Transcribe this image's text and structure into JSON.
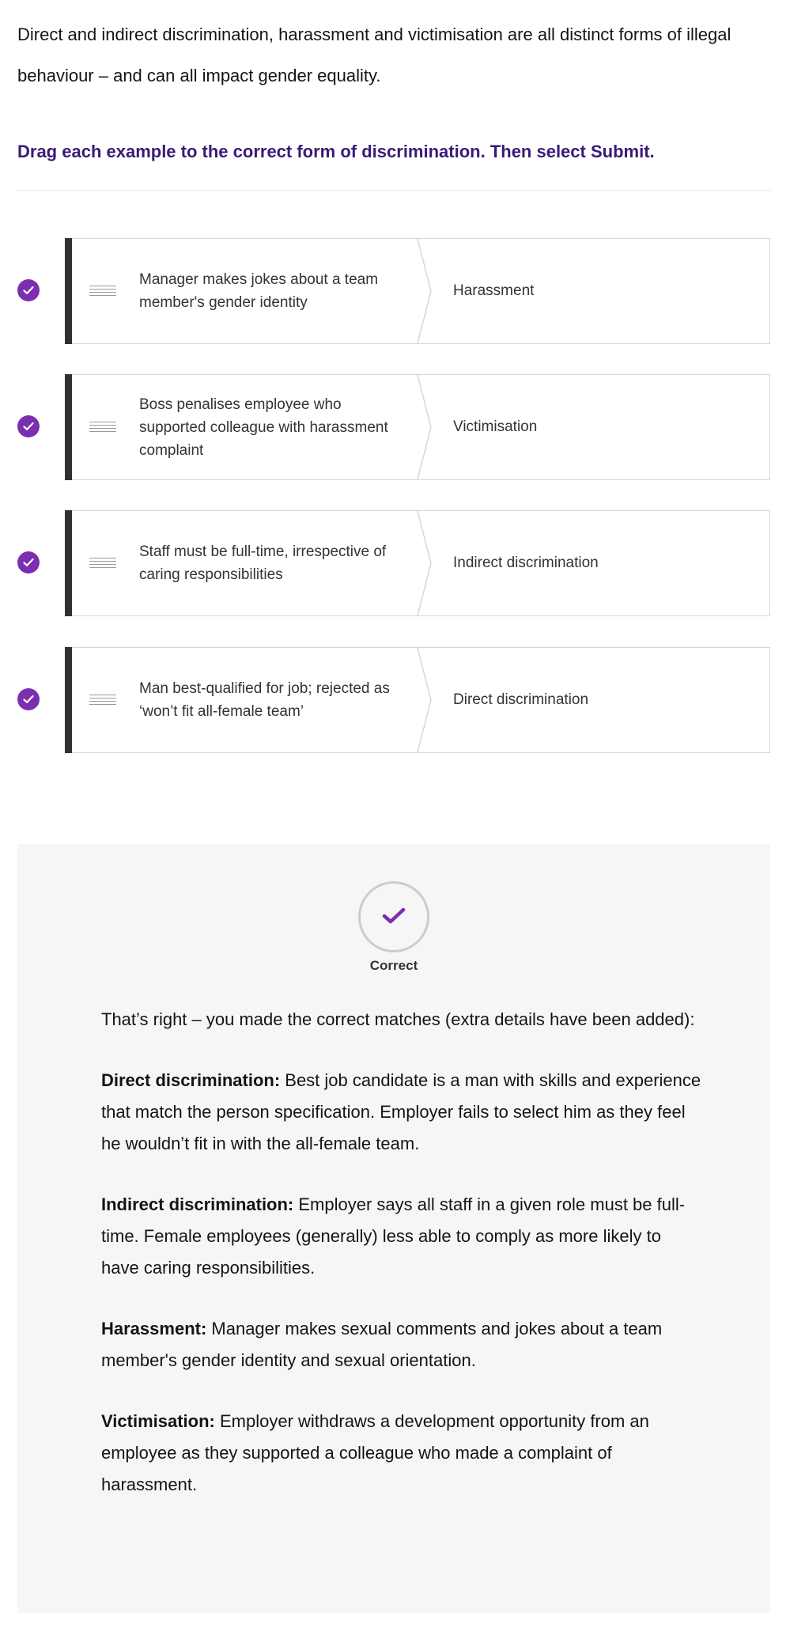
{
  "intro": {
    "text": "Direct and indirect discrimination, harassment and victimisation are all distinct forms of illegal behaviour – and can all impact gender equality."
  },
  "instruction": "Drag each example to the correct form of discrimination. Then select Submit.",
  "colors": {
    "accent": "#7b2fb0",
    "instruction": "#3b1a78",
    "card_bar": "#2f3033",
    "feedback_bg": "#f6f6f6"
  },
  "matches": [
    {
      "example": "Manager makes jokes about a team member's gender identity",
      "target": "Harassment",
      "status_icon": "check-icon"
    },
    {
      "example": "Boss penalises employee who supported colleague with harassment complaint",
      "target": "Victimisation",
      "status_icon": "check-icon"
    },
    {
      "example": "Staff must be full-time, irrespective of caring responsibilities",
      "target": "Indirect discrimination",
      "status_icon": "check-icon"
    },
    {
      "example": "Man best-qualified for job; rejected as ‘won’t fit all-female team’",
      "target": "Direct discrimination",
      "status_icon": "check-icon"
    }
  ],
  "feedback": {
    "result_icon": "checkmark-icon",
    "result_label": "Correct",
    "intro": "That’s right – you made the correct matches (extra details have been added):",
    "items": [
      {
        "term": "Direct discrimination:",
        "description": " Best job candidate is a man with skills and experience that match the person specification. Employer fails to select him as they feel he wouldn’t fit in with the all-female team."
      },
      {
        "term": "Indirect discrimination:",
        "description": " Employer says all staff in a given role must be full-time. Female employees (generally) less able to comply as more likely to have caring responsibilities."
      },
      {
        "term": "Harassment:",
        "description": " Manager makes sexual comments and jokes about a team member's gender identity and sexual orientation."
      },
      {
        "term": "Victimisation:",
        "description": " Employer withdraws a development opportunity from an employee as they supported a colleague who made a complaint of harassment."
      }
    ]
  }
}
